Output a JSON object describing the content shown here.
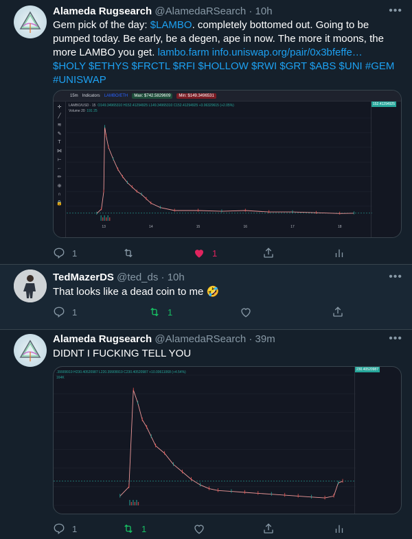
{
  "tweets": [
    {
      "name": "Alameda Rugsearch",
      "handle": "@AlamedaRSearch",
      "time": "10h",
      "text_parts": {
        "p1": "Gem pick of the day: ",
        "cashtag_lambo": "$LAMBO",
        "p2": ". completely bottomed out. Going to be pumped today. Be early, be a degen, ape in now. The more it moons, the more LAMBO you get. ",
        "link1": "lambo.farm",
        "link2": "info.uniswap.org/pair/0x3bfeffe…",
        "tags": "$HOLY $ETHYS $FRCTL $RFI $HOLLOW $RWI $GRT $ABS $UNI #GEM #UNISWAP"
      },
      "reply_count": "1",
      "retweet_count": "",
      "like_count": "1",
      "liked": true,
      "chart": {
        "interval": "15m",
        "indicators_label": "Indicators",
        "pair": "LAMBO/ETH",
        "max_label": "Max: $742.5829609",
        "min_label": "Min: $149.3496531",
        "symbol": "LAMBO/USD · 15",
        "ohlc": "O149.34965310 H152.41294925 L149.34965310 C152.41294925 +3.06329615 (+2.05%)",
        "volume_label": "Volume 20",
        "volume_values": "191  25",
        "price_label": "152.41294925",
        "y_ticks": [
          "800.00000000",
          "700.00000000",
          "600.00000000",
          "500.00000000",
          "400.00000000",
          "300.00000000",
          "200.00000000"
        ],
        "x_ticks": [
          "13",
          "14",
          "15",
          "16",
          "17",
          "18"
        ]
      }
    },
    {
      "name": "TedMazerDS",
      "handle": "@ted_ds",
      "time": "10h",
      "text": "That looks like a dead coin to me 🤣",
      "reply_count": "1",
      "retweet_count": "1",
      "like_count": "",
      "retweeted": true
    },
    {
      "name": "Alameda Rugsearch",
      "handle": "@AlamedaRSearch",
      "time": "39m",
      "text": "DIDNT I FUCKING TELL YOU",
      "reply_count": "1",
      "retweet_count": "1",
      "like_count": "",
      "retweeted": true,
      "chart": {
        "ohlc": ".39909919  H230.40520987  L220.39909919  C230.40520987  +10.00611068 (+4.54%)",
        "vol": "164K",
        "price_label": "230.40520987",
        "y_ticks": [
          "800.00000000",
          "700.00000000",
          "600.00000000",
          "500.00000000",
          "400.00000000",
          "300.00000000",
          "200.00000000",
          "100.00000000"
        ]
      }
    }
  ],
  "colors": {
    "accent": "#1da1f2",
    "like": "#e0245e",
    "retweet": "#17bf63",
    "muted": "#8899a6",
    "bg": "#15202b"
  },
  "chart_data": [
    {
      "type": "line",
      "title": "",
      "xlabel": "",
      "ylabel": "",
      "x_ticks": [
        "13",
        "14",
        "15",
        "16",
        "17",
        "18"
      ],
      "ylim": [
        100,
        800
      ],
      "series": [
        {
          "name": "LAMBO/USD",
          "x": [
            12.85,
            12.95,
            13.0,
            13.02,
            13.05,
            13.1,
            13.2,
            13.3,
            13.4,
            13.5,
            13.6,
            13.7,
            13.8,
            13.9,
            14.0,
            14.2,
            14.5,
            15.0,
            15.5,
            16.0,
            16.5,
            17.0,
            17.5,
            18.0,
            18.3
          ],
          "y": [
            150,
            180,
            300,
            740,
            680,
            600,
            520,
            450,
            400,
            360,
            330,
            300,
            280,
            250,
            220,
            190,
            170,
            170,
            165,
            170,
            160,
            160,
            155,
            150,
            152
          ]
        }
      ]
    },
    {
      "type": "line",
      "title": "",
      "xlabel": "",
      "ylabel": "",
      "ylim": [
        100,
        800
      ],
      "series": [
        {
          "name": "",
          "x": [
            0,
            2,
            3,
            4,
            5,
            6,
            7,
            8,
            10,
            12,
            14,
            16,
            18,
            20,
            22,
            25,
            28,
            31,
            34,
            37,
            40,
            43,
            46,
            48,
            49,
            50
          ],
          "y": [
            150,
            200,
            720,
            650,
            560,
            520,
            470,
            420,
            380,
            320,
            280,
            240,
            210,
            190,
            180,
            175,
            170,
            165,
            160,
            155,
            150,
            145,
            140,
            150,
            220,
            230
          ]
        }
      ]
    }
  ]
}
